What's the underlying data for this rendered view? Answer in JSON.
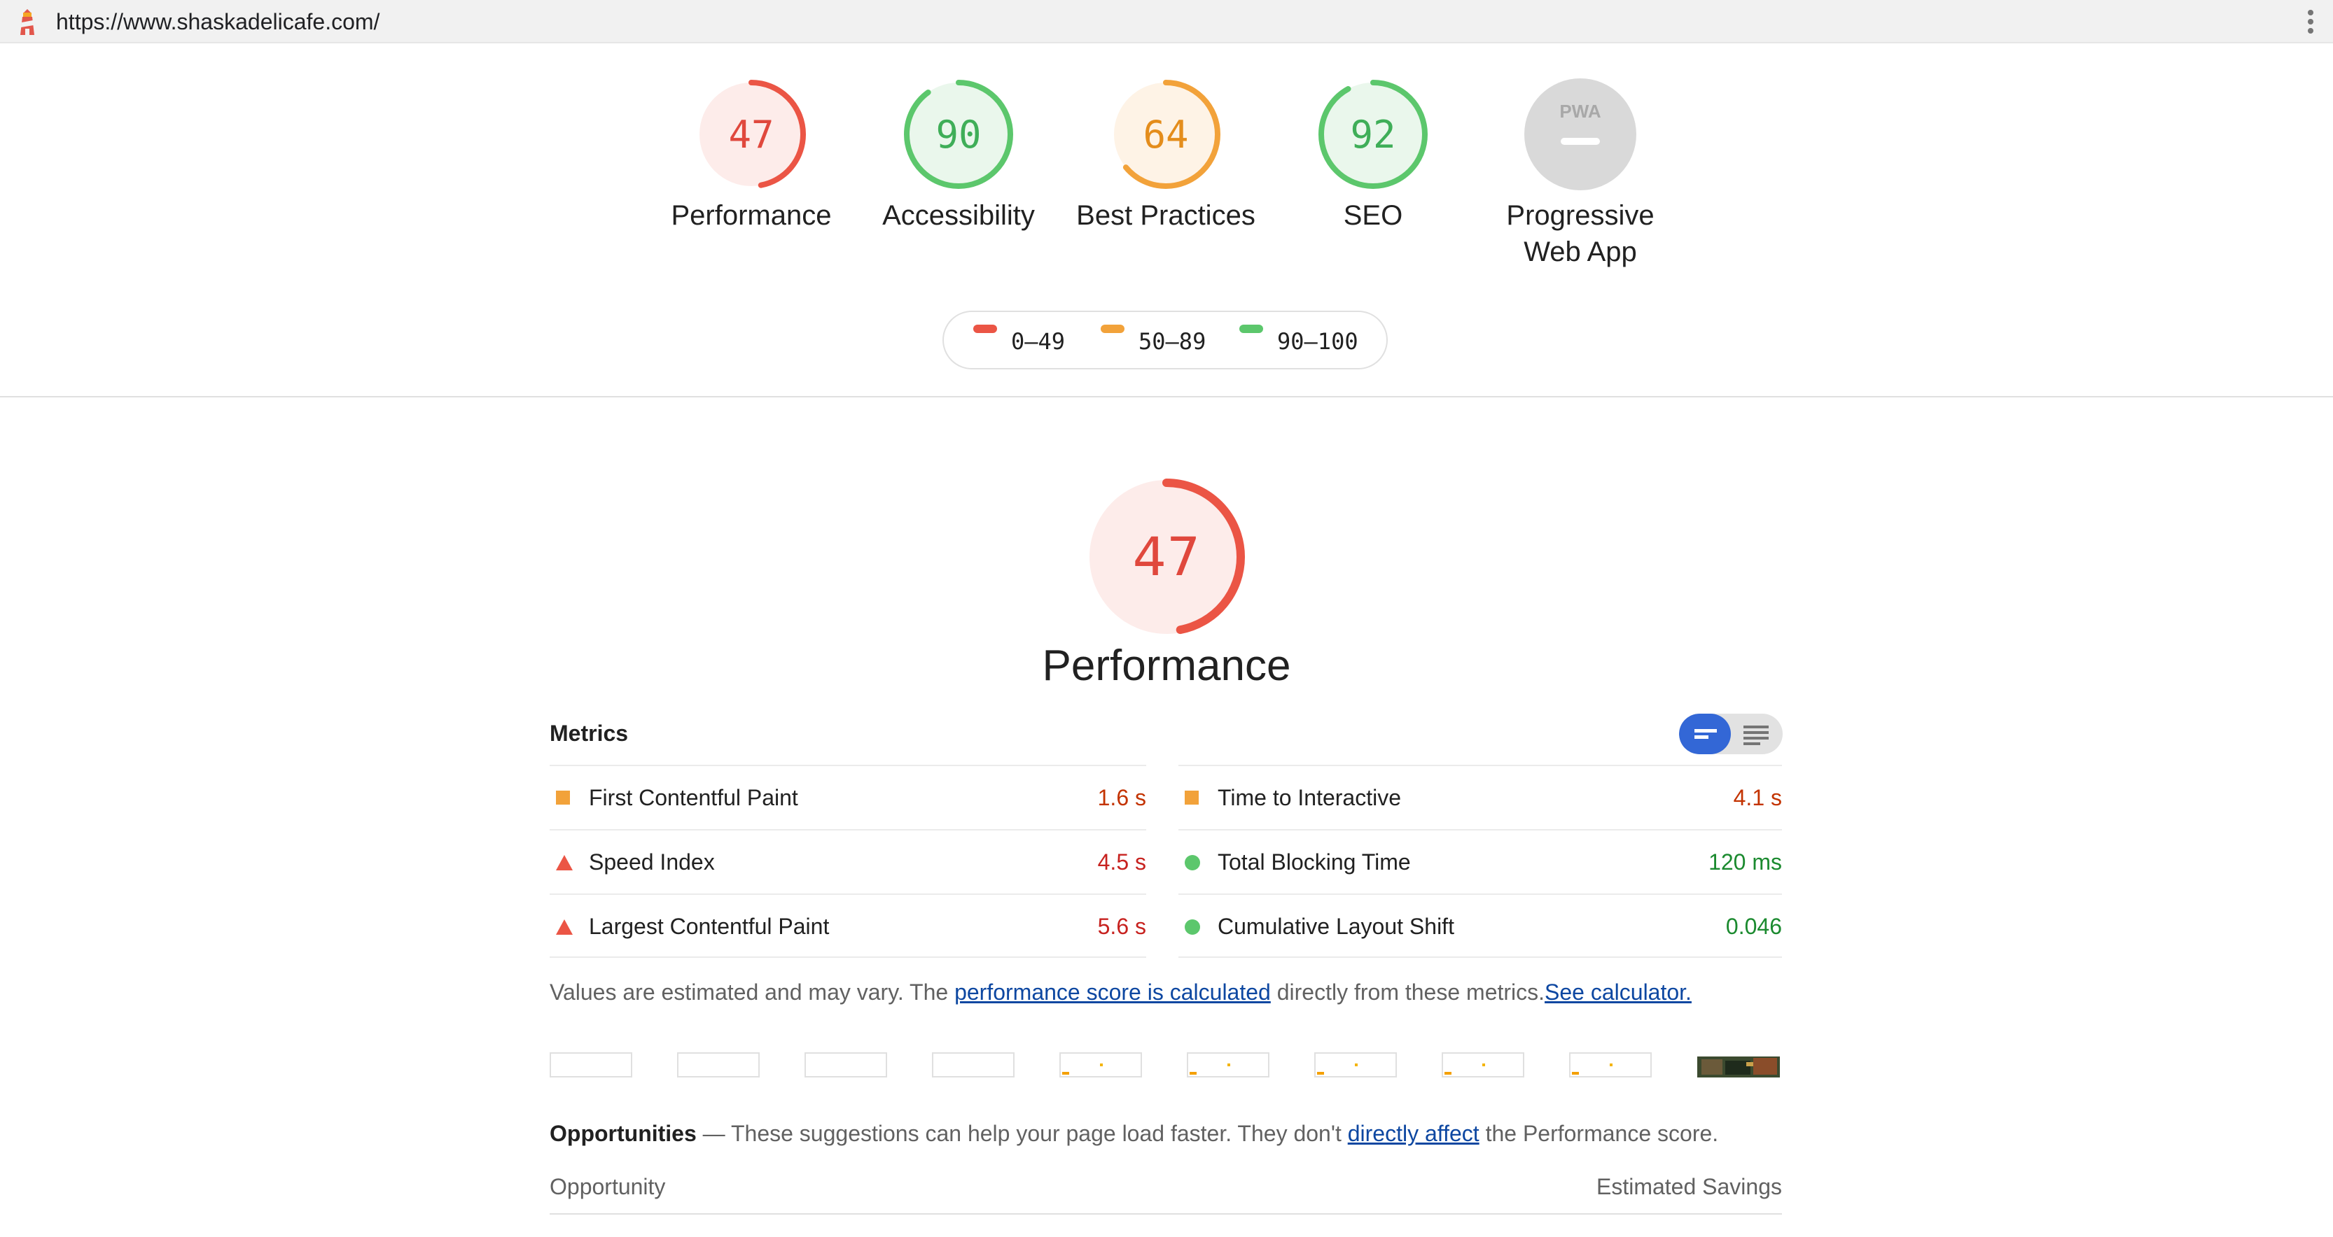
{
  "browser": {
    "url": "https://www.shaskadelicafe.com/"
  },
  "colors": {
    "fail": "#eb5545",
    "average": "#f2a23a",
    "pass": "#5cc76c",
    "na": "#d9d9d9",
    "link": "#0d47a1",
    "accent": "#3367d6"
  },
  "gauges": [
    {
      "label": "Performance",
      "score": "47",
      "fraction": 0.47,
      "rating": "fail"
    },
    {
      "label": "Accessibility",
      "score": "90",
      "fraction": 0.9,
      "rating": "pass"
    },
    {
      "label": "Best Practices",
      "score": "64",
      "fraction": 0.64,
      "rating": "average"
    },
    {
      "label": "SEO",
      "score": "92",
      "fraction": 0.92,
      "rating": "pass"
    },
    {
      "label": "Progressive Web App",
      "label_line1": "Progressive",
      "label_line2": "Web App",
      "icon_text": "PWA",
      "rating": "na"
    }
  ],
  "legend": {
    "fail": "0–49",
    "average": "50–89",
    "pass": "90–100"
  },
  "performance": {
    "score": "47",
    "fraction": 0.47,
    "title": "Performance"
  },
  "metrics": {
    "heading": "Metrics",
    "left": [
      {
        "name": "First Contentful Paint",
        "value": "1.6 s",
        "rating": "average"
      },
      {
        "name": "Speed Index",
        "value": "4.5 s",
        "rating": "fail"
      },
      {
        "name": "Largest Contentful Paint",
        "value": "5.6 s",
        "rating": "fail"
      }
    ],
    "right": [
      {
        "name": "Time to Interactive",
        "value": "4.1 s",
        "rating": "average"
      },
      {
        "name": "Total Blocking Time",
        "value": "120 ms",
        "rating": "pass"
      },
      {
        "name": "Cumulative Layout Shift",
        "value": "0.046",
        "rating": "pass"
      }
    ]
  },
  "note": {
    "prefix": "Values are estimated and may vary. The ",
    "link1": "performance score is calculated",
    "middle": " directly from these metrics.",
    "link2": "See calculator."
  },
  "opportunities": {
    "title": "Opportunities",
    "dash": " — ",
    "text": "These suggestions can help your page load faster. They don't ",
    "link": "directly affect",
    "suffix": " the Performance score.",
    "col_left": "Opportunity",
    "col_right": "Estimated Savings"
  }
}
